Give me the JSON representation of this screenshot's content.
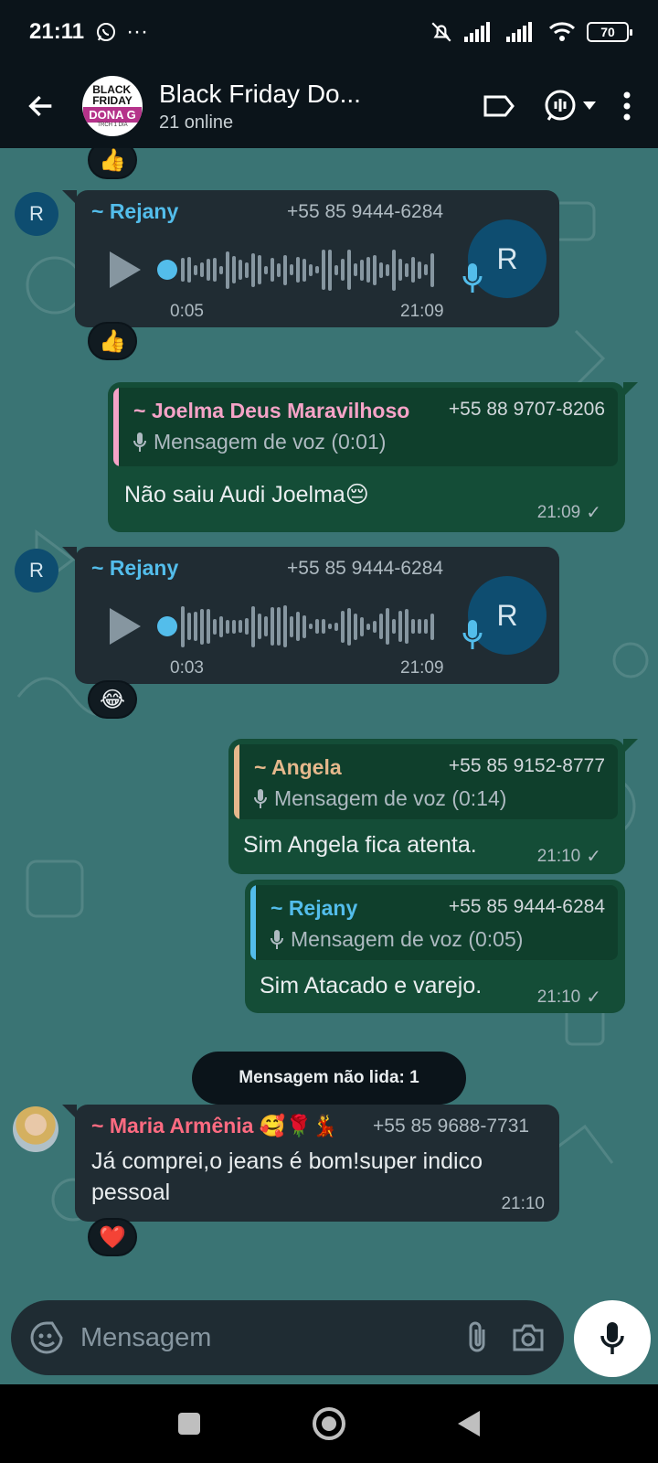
{
  "status_bar": {
    "time": "21:11",
    "battery": "70",
    "more": "···"
  },
  "header": {
    "title": "Black Friday Do...",
    "subtitle": "21 online"
  },
  "messages": {
    "m1": {
      "sender": "~ Rejany",
      "phone": "+55 85 9444-6284",
      "duration": "0:05",
      "time": "21:09",
      "avatar_letter": "R",
      "reaction": "👍"
    },
    "m2": {
      "quote_name": "~ Joelma Deus Maravilhoso",
      "quote_phone": "+55 88 9707-8206",
      "quote_text": "Mensagem de voz (0:01)",
      "text": "Não saiu Audi Joelma😔",
      "time": "21:09",
      "tick": "✓"
    },
    "m3": {
      "sender": "~ Rejany",
      "phone": "+55 85 9444-6284",
      "duration": "0:03",
      "time": "21:09",
      "avatar_letter": "R",
      "reaction": "😂"
    },
    "m4": {
      "quote_name": "~ Angela",
      "quote_phone": "+55 85 9152-8777",
      "quote_text": "Mensagem de voz (0:14)",
      "text": "Sim Angela fica atenta.",
      "time": "21:10",
      "tick": "✓"
    },
    "m5": {
      "quote_name": "~ Rejany",
      "quote_phone": "+55 85 9444-6284",
      "quote_text": "Mensagem de voz (0:05)",
      "text": "Sim Atacado e varejo.",
      "time": "21:10",
      "tick": "✓"
    },
    "unread_label": "Mensagem não lida: 1",
    "m6": {
      "sender": "~ Maria Armênia 🥰🌹💃",
      "phone": "+55 85 9688-7731",
      "text_line1": "Já comprei,o jeans é bom!super indico",
      "text_line2": "pessoal",
      "time": "21:10",
      "reaction": "❤️"
    },
    "top_reaction": "👍"
  },
  "input": {
    "placeholder": "Mensagem"
  },
  "colors": {
    "rejany": "#53bdeb",
    "joelma": "#f5a3c7",
    "angela": "#e5b88c",
    "maria": "#ff6b81",
    "accent": "#53bdeb"
  }
}
